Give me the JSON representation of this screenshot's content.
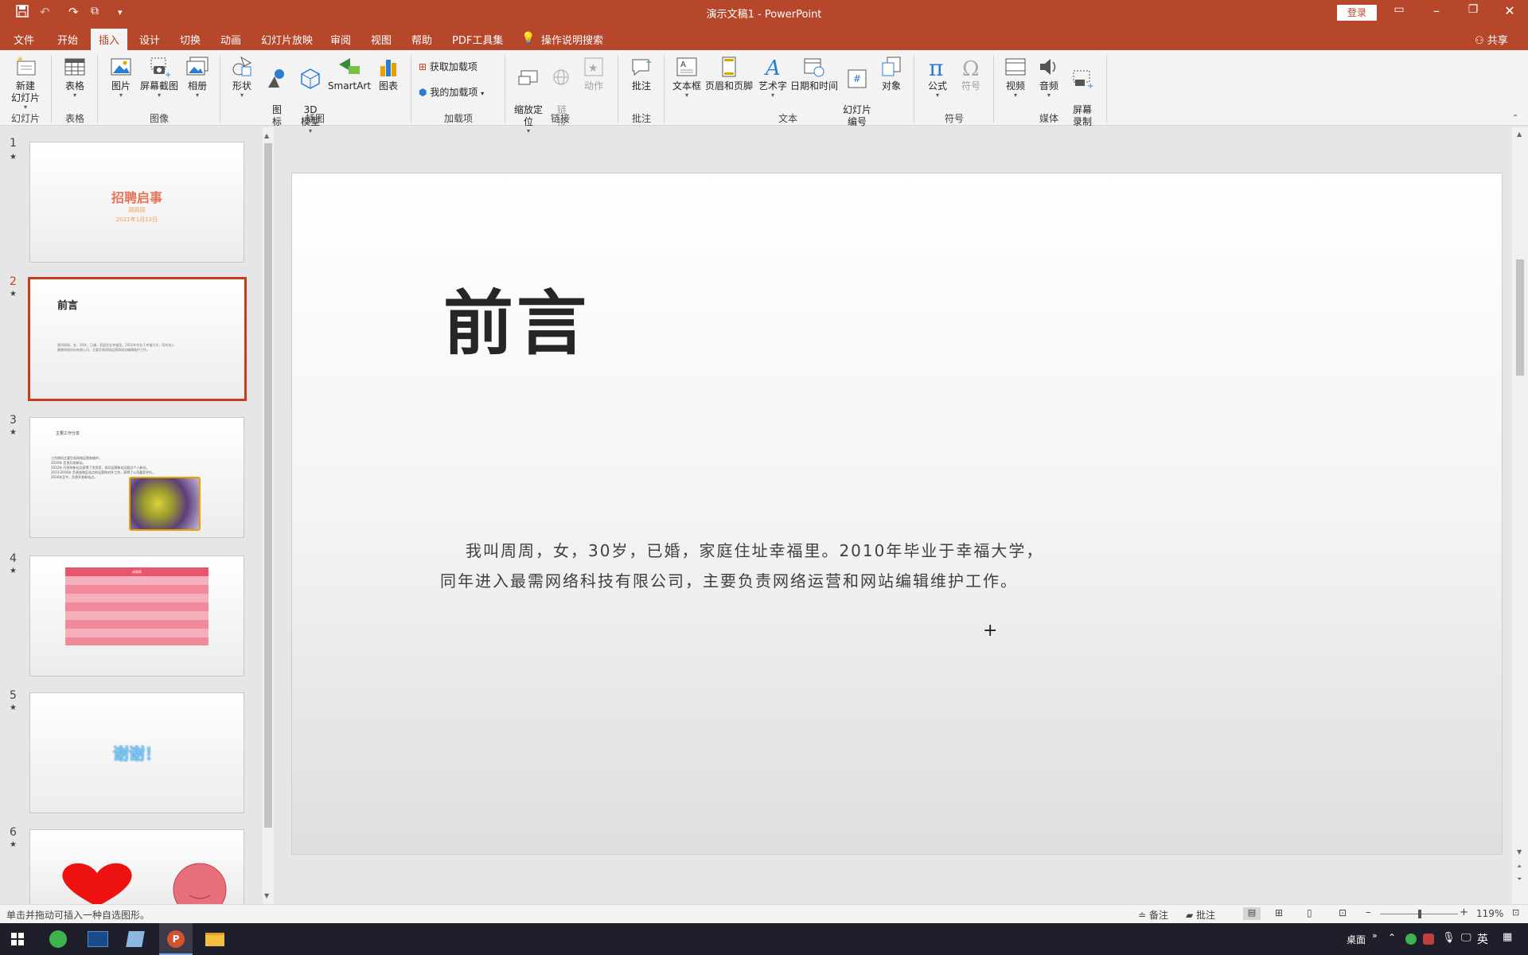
{
  "window": {
    "title": "演示文稿1 - PowerPoint",
    "login": "登录",
    "share": "共享"
  },
  "tabs": [
    {
      "label": "文件"
    },
    {
      "label": "开始"
    },
    {
      "label": "插入",
      "active": true
    },
    {
      "label": "设计"
    },
    {
      "label": "切换"
    },
    {
      "label": "动画"
    },
    {
      "label": "幻灯片放映"
    },
    {
      "label": "审阅"
    },
    {
      "label": "视图"
    },
    {
      "label": "帮助"
    },
    {
      "label": "PDF工具集"
    },
    {
      "label": "操作说明搜索"
    }
  ],
  "ribbon": {
    "new_slide": "新建\n幻灯片",
    "table": "表格",
    "picture": "图片",
    "screenshot": "屏幕截图",
    "album": "相册",
    "shapes": "形状",
    "icons": "图\n标",
    "model3d": "3D\n模型",
    "smartart": "SmartArt",
    "chart": "图表",
    "get_addins": "获取加载项",
    "my_addins": "我的加载项",
    "zoom": "缩放定\n位",
    "link": "链\n接",
    "action": "动作",
    "comment": "批注",
    "textbox": "文本框",
    "header_footer": "页眉和页脚",
    "wordart": "艺术字",
    "datetime": "日期和时间",
    "slide_number": "幻灯片\n编号",
    "object": "对象",
    "equation": "公式",
    "symbol": "符号",
    "video": "视频",
    "audio": "音频",
    "screen_record": "屏幕\n录制",
    "groups": {
      "slides": "幻灯片",
      "tables": "表格",
      "images": "图像",
      "illustrations": "插图",
      "addins": "加载项",
      "links": "链接",
      "comments": "批注",
      "text": "文本",
      "symbols": "符号",
      "media": "媒体"
    }
  },
  "thumbnails": [
    {
      "num": "1",
      "title": "招聘启事",
      "sub1": "周周周",
      "sub2": "2021年1月12日"
    },
    {
      "num": "2",
      "title": "前言",
      "body": "我叫周周，女，30岁，已婚，家庭住址幸福里。2010年毕业于幸福大学，同年进入最需网络科技有限公司，主要负责网络运营和网站编辑维护工作。"
    },
    {
      "num": "3",
      "title": "主要工作分享",
      "lines": [
        "工作期间主要负责网络运营和维护。",
        "2010年 负责开发新站。",
        "2012年 开发的新站点获得了优秀奖，成功运营新站点超过个人新站。",
        "2013-2016年 负责各地区站点的运营和对外工作，获得了公司嘉奖评价。",
        "2016年至今，负责开发新站点。"
      ]
    },
    {
      "num": "4",
      "title": "成绩表"
    },
    {
      "num": "5",
      "title": "谢谢！"
    },
    {
      "num": "6"
    }
  ],
  "slide": {
    "title": "前言",
    "body_line1": "我叫周周，女，30岁，已婚，家庭住址幸福里。2010年毕业于幸福大学，",
    "body_line2": "同年进入最需网络科技有限公司，主要负责网络运营和网站编辑维护工作。"
  },
  "status": {
    "hint": "单击并拖动可插入一种自选图形。",
    "notes": "备注",
    "comments": "批注",
    "zoom": "119%"
  },
  "taskbar": {
    "desktop": "桌面",
    "ime": "英"
  }
}
